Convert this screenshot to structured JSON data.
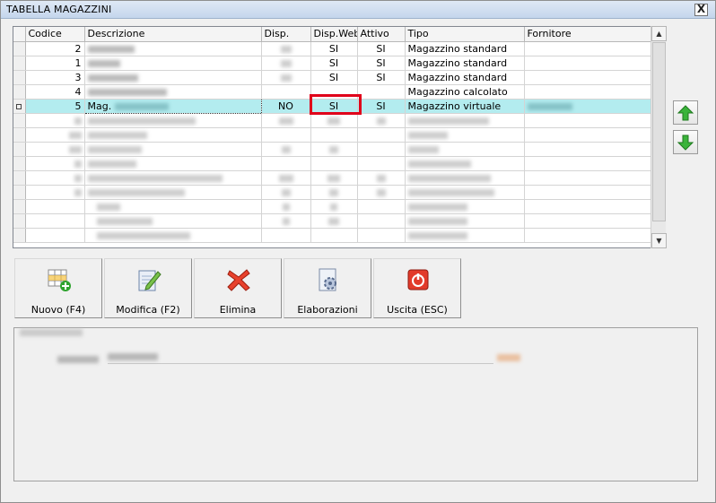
{
  "window": {
    "title": "TABELLA MAGAZZINI",
    "close_label": "X"
  },
  "grid": {
    "columns": [
      "Codice",
      "Descrizione",
      "Disp.",
      "Disp.Web",
      "Attivo",
      "Tipo",
      "Fornitore"
    ],
    "rows": [
      {
        "codice": "2",
        "disp": "",
        "web": "SI",
        "attivo": "SI",
        "tipo": "Magazzino standard",
        "selected": false
      },
      {
        "codice": "1",
        "disp": "",
        "web": "SI",
        "attivo": "SI",
        "tipo": "Magazzino standard",
        "selected": false
      },
      {
        "codice": "3",
        "disp": "",
        "web": "SI",
        "attivo": "SI",
        "tipo": "Magazzino standard",
        "selected": false
      },
      {
        "codice": "4",
        "disp": "",
        "web": "",
        "attivo": "",
        "tipo": "Magazzino calcolato",
        "selected": false
      },
      {
        "codice": "5",
        "descrizione": "Mag.",
        "disp": "NO",
        "web": "SI",
        "attivo": "SI",
        "tipo": "Magazzino virtuale",
        "selected": true
      }
    ]
  },
  "toolbar": {
    "nuovo": "Nuovo (F4)",
    "modifica": "Modifica (F2)",
    "elimina": "Elimina",
    "elaborazioni": "Elaborazioni",
    "uscita": "Uscita (ESC)"
  },
  "colors": {
    "selected_row": "#b3ecef",
    "highlight_frame": "#e0001a",
    "arrow_green": "#3bb33b"
  },
  "icons": [
    "up-arrow-icon",
    "down-arrow-icon",
    "grid-add-icon",
    "edit-pencil-icon",
    "delete-x-icon",
    "gears-icon",
    "power-icon"
  ]
}
